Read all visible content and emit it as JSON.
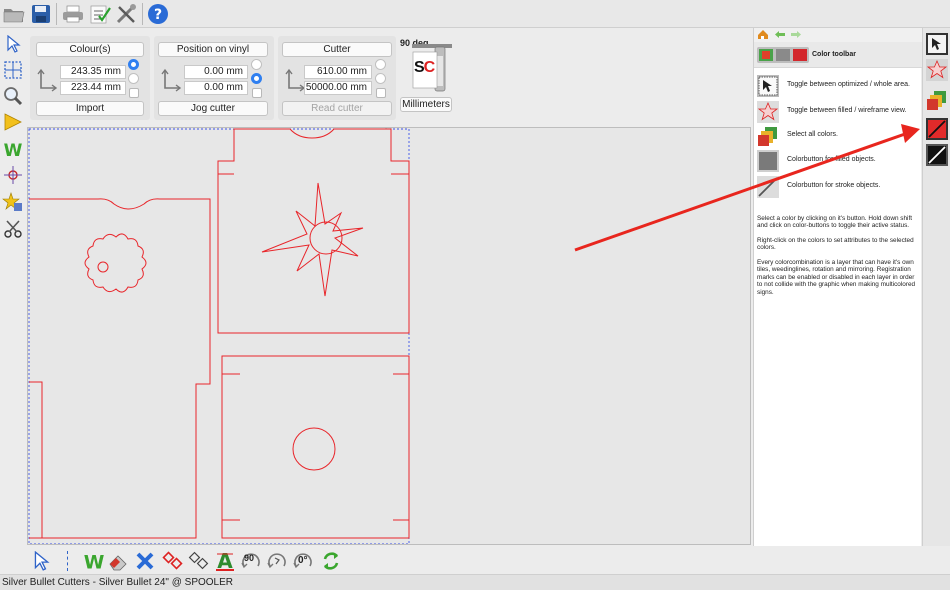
{
  "top_toolbar": {
    "icons": [
      "open-folder-icon",
      "save-icon",
      "print-icon",
      "checklist-icon",
      "tools-icon",
      "help-icon"
    ]
  },
  "left_tools": {
    "icons": [
      "select-arrow-icon",
      "node-edit-icon",
      "zoom-icon",
      "ruler-icon",
      "weed-icon",
      "registration-mark-icon",
      "star-tool-icon",
      "knife-icon"
    ]
  },
  "params": {
    "colours": {
      "button_label": "Colour(s)",
      "width": "243.35 mm",
      "height": "223.44 mm",
      "import_label": "Import"
    },
    "position": {
      "button_label": "Position on vinyl",
      "x": "0.00 mm",
      "y": "0.00 mm",
      "jog_label": "Jog cutter"
    },
    "cutter": {
      "button_label": "Cutter",
      "width": "610.00 mm",
      "length": "50000.00 mm",
      "read_label": "Read cutter"
    },
    "rotation_label": "90 deg",
    "units_label": "Millimeters",
    "cutter_logo": "SC"
  },
  "right_panel": {
    "title": "Color toolbar",
    "items": [
      {
        "label": "Toggle between optimized / whole area."
      },
      {
        "label": "Toggle between filled / wireframe view."
      },
      {
        "label": "Select all colors."
      },
      {
        "label": "Colorbutton for filled objects."
      },
      {
        "label": "Colorbutton for stroke objects."
      }
    ],
    "help_paragraphs": [
      "Select a color by clicking on it's button. Hold down shift and click on color-buttons to toggle their active status.",
      "Right-click on the colors to set attributes to the selected colors.",
      "Every colorcombination is a layer that can have it's own tiles, weedinglines, rotation and mirroring. Registration marks can be enabled or disabled in each layer in order to not collide with the graphic when making multicolored signs."
    ]
  },
  "bottom_toolbar": {
    "icons": [
      "select-arrow-icon",
      "weed-icon",
      "eraser-icon",
      "delete-x-icon",
      "registration-red-icon",
      "registration-outline-icon",
      "text-weed-icon",
      "rotate-90-icon",
      "rotate-icon",
      "rotate-0-icon",
      "refresh-icon"
    ],
    "rotate_90_label": "90",
    "rotate_0_label": "0°"
  },
  "status": {
    "text": "Silver Bullet Cutters - Silver Bullet 24\" @ SPOOLER"
  },
  "colors": {
    "cut_line": "#e8262b",
    "accent_blue": "#2f7ff0",
    "annotation_arrow": "#e8261e"
  }
}
